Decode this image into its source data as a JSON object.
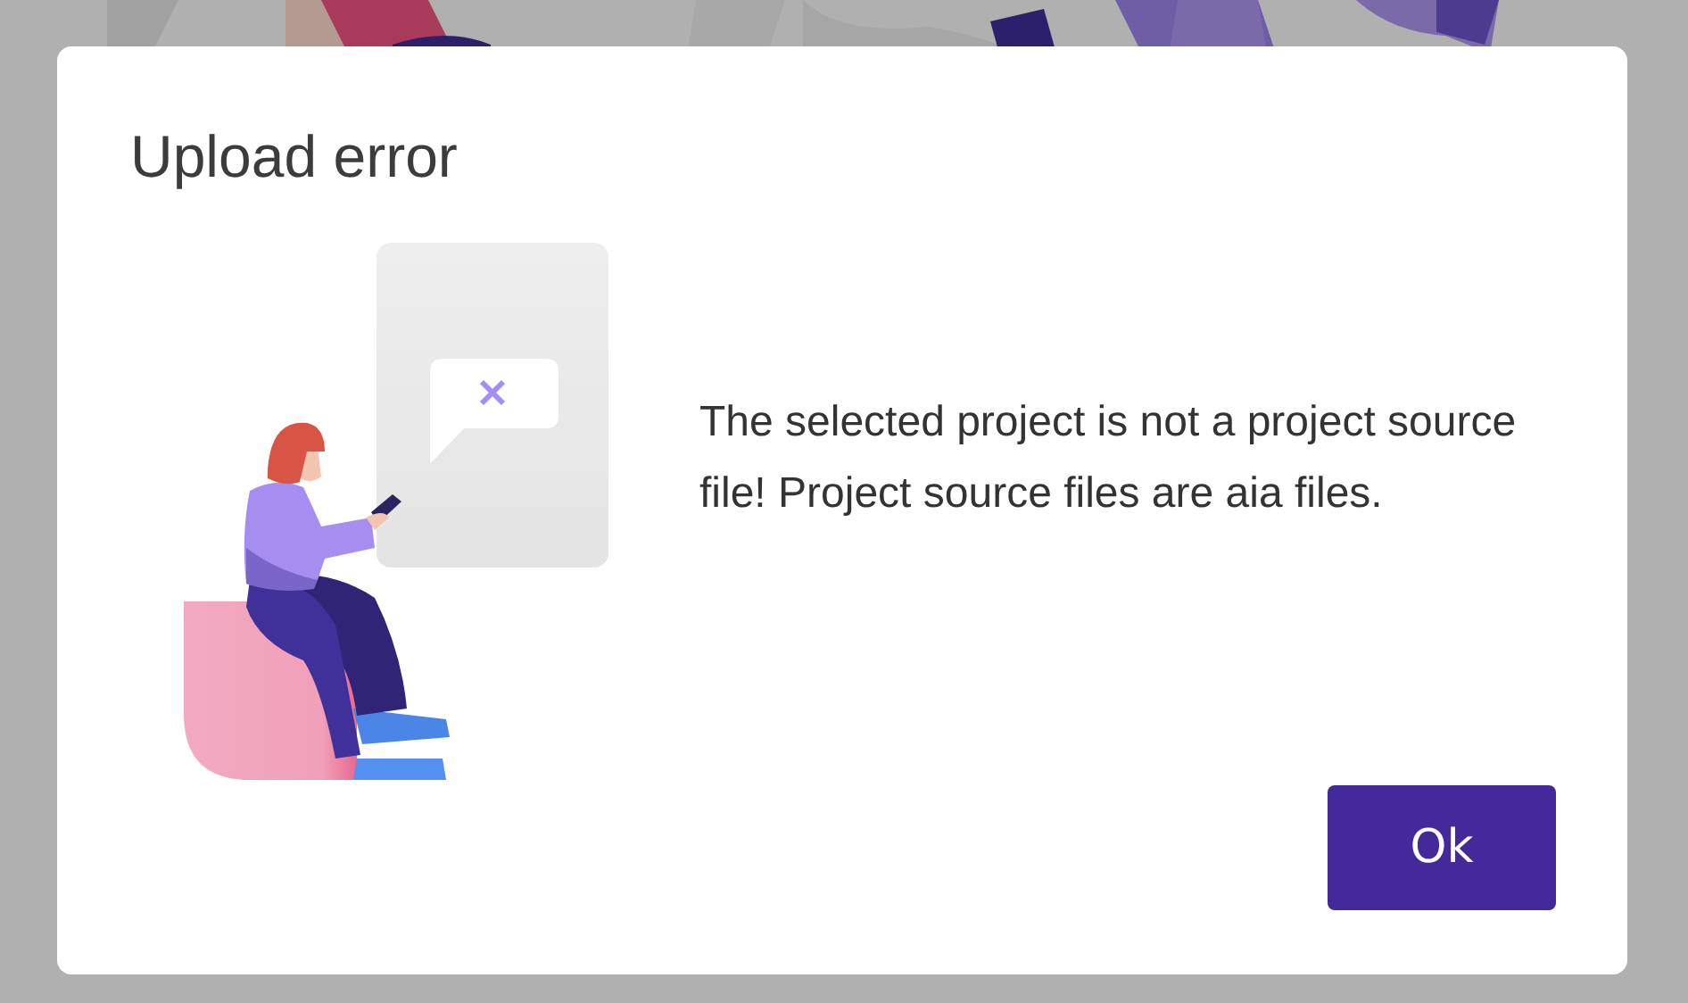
{
  "dialog": {
    "title": "Upload error",
    "message": "The selected project is not a project source file! Project source files are aia files.",
    "buttons": [
      {
        "label": "Ok"
      }
    ]
  }
}
